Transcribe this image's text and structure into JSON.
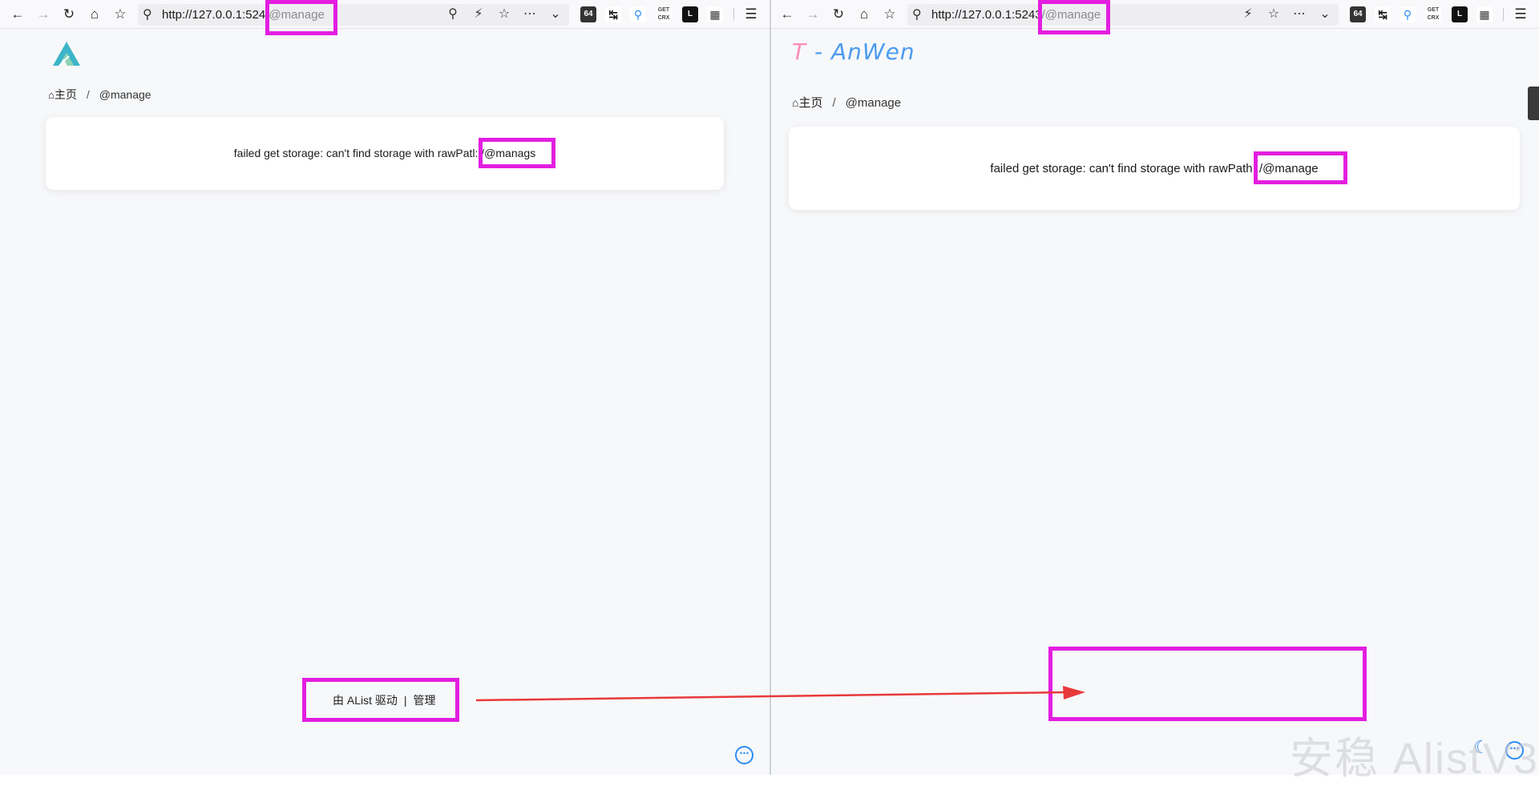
{
  "left_window": {
    "url": {
      "host": "http://127.0.0.1:524",
      "path": "/@manage"
    },
    "breadcrumb": {
      "home": "主页",
      "separator": "/",
      "current": "@manage"
    },
    "error": {
      "prefix": "failed get storage: can't find storage with rawPatl",
      "path": ": /@manags"
    },
    "footer": {
      "powered_by": "由 AList 驱动",
      "separator": "|",
      "manage_link": "管理"
    }
  },
  "right_window": {
    "url": {
      "host": "http://127.0.0.1:5243",
      "path": "/@manage"
    },
    "site_title": {
      "t": "T",
      "dash": "-",
      "name": "AnWen"
    },
    "breadcrumb": {
      "home": "主页",
      "separator": "/",
      "current": "@manage"
    },
    "error": {
      "prefix": "failed get storage: can't find storage with rawPat",
      "path": "h: /@manage"
    }
  },
  "watermark": "安稳 AlistV3",
  "colors": {
    "highlight": "#e31ee0",
    "arrow": "#e8393a",
    "accent": "#2c8cf4",
    "page_background": "#f7f8fa"
  },
  "icons": {
    "back": "arrow-left-icon",
    "forward": "arrow-right-icon",
    "reload": "reload-icon",
    "home": "home-icon",
    "bookmarks": "star-list-icon",
    "search": "search-icon",
    "zoom": "zoom-icon",
    "lightning": "lightning-icon",
    "star": "star-icon",
    "more": "more-icon",
    "menu": "hamburger-icon",
    "settings_bubble": "more-circle-icon",
    "theme": "moon-icon"
  }
}
